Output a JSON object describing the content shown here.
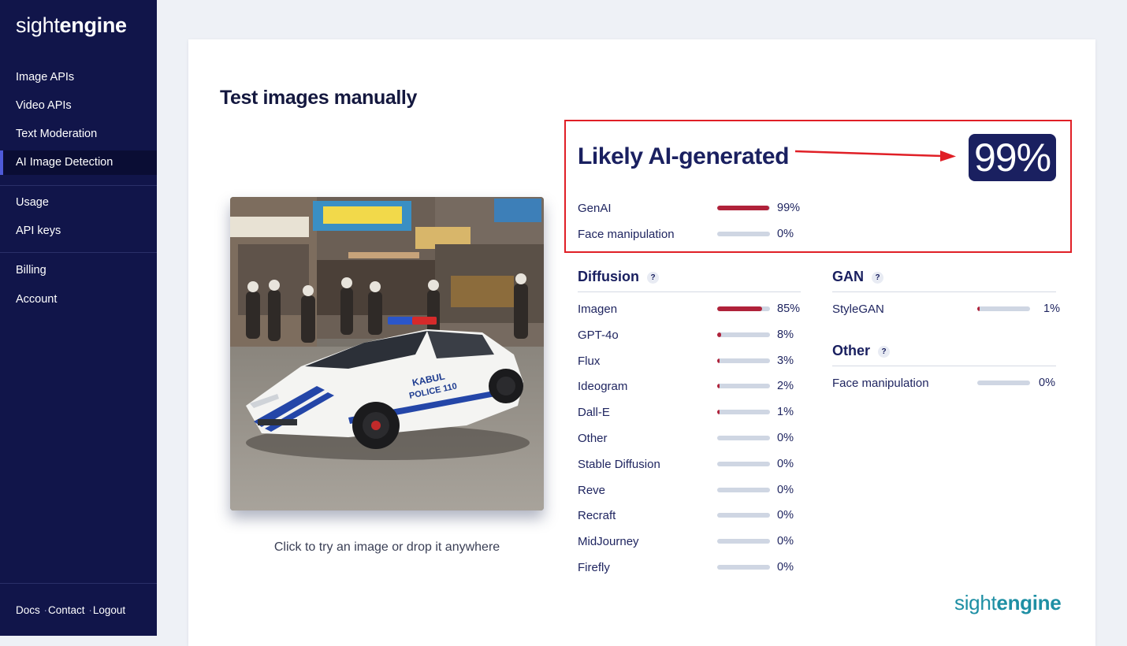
{
  "app": {
    "logo_light": "sight",
    "logo_bold": "engine"
  },
  "sidebar": {
    "items": [
      {
        "label": "Image APIs"
      },
      {
        "label": "Video APIs"
      },
      {
        "label": "Text Moderation"
      },
      {
        "label": "AI Image Detection",
        "active": true
      },
      {
        "label": "Usage"
      },
      {
        "label": "API keys"
      },
      {
        "label": "Billing"
      },
      {
        "label": "Account"
      }
    ],
    "footer": {
      "docs": "Docs",
      "contact": "Contact",
      "logout": "Logout",
      "separator": "·"
    }
  },
  "main": {
    "title": "Test images manually",
    "upload_hint": "Click to try an image or drop it anywhere",
    "image_text": {
      "car_line1": "KABUL",
      "car_line2": "POLICE 110"
    },
    "result": {
      "verdict": "Likely AI-generated",
      "score": "99%",
      "summary": [
        {
          "label": "GenAI",
          "value": 99,
          "text": "99%"
        },
        {
          "label": "Face manipulation",
          "value": 0,
          "text": "0%"
        }
      ]
    },
    "diffusion": {
      "title": "Diffusion",
      "help": "?",
      "items": [
        {
          "label": "Imagen",
          "value": 85,
          "text": "85%"
        },
        {
          "label": "GPT-4o",
          "value": 8,
          "text": "8%"
        },
        {
          "label": "Flux",
          "value": 3,
          "text": "3%"
        },
        {
          "label": "Ideogram",
          "value": 2,
          "text": "2%"
        },
        {
          "label": "Dall-E",
          "value": 1,
          "text": "1%"
        },
        {
          "label": "Other",
          "value": 0,
          "text": "0%"
        },
        {
          "label": "Stable Diffusion",
          "value": 0,
          "text": "0%"
        },
        {
          "label": "Reve",
          "value": 0,
          "text": "0%"
        },
        {
          "label": "Recraft",
          "value": 0,
          "text": "0%"
        },
        {
          "label": "MidJourney",
          "value": 0,
          "text": "0%"
        },
        {
          "label": "Firefly",
          "value": 0,
          "text": "0%"
        }
      ]
    },
    "gan": {
      "title": "GAN",
      "help": "?",
      "items": [
        {
          "label": "StyleGAN",
          "value": 1,
          "text": "1%"
        }
      ]
    },
    "other": {
      "title": "Other",
      "help": "?",
      "items": [
        {
          "label": "Face manipulation",
          "value": 0,
          "text": "0%"
        }
      ]
    },
    "brand_light": "sight",
    "brand_bold": "engine"
  },
  "colors": {
    "sidebar_bg": "#11154a",
    "accent_navy": "#1a2060",
    "bar_fill": "#b0223a",
    "bar_track": "#cfd6e3",
    "highlight_red": "#e01f26",
    "brand_teal": "#1e8fa4"
  }
}
